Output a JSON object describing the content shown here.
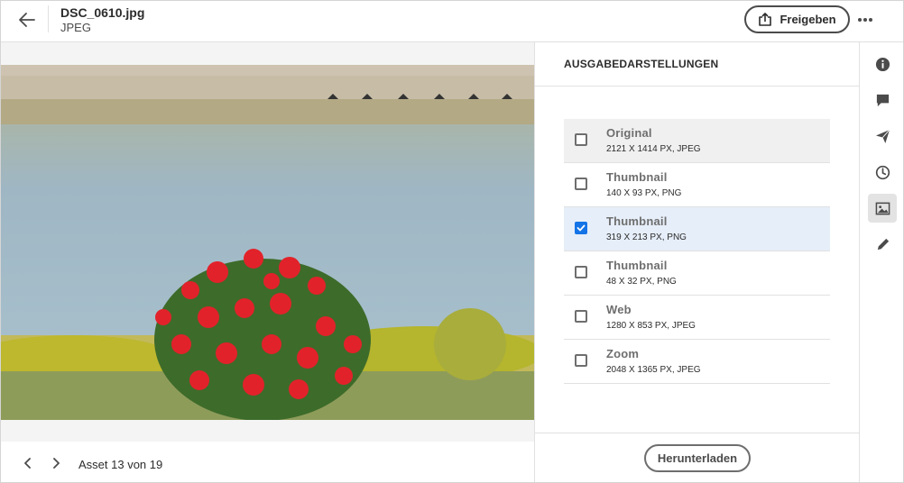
{
  "header": {
    "file_name": "DSC_0610.jpg",
    "file_type": "JPEG",
    "share_label": "Freigeben",
    "back_icon": "arrow-left-icon",
    "more_icon": "more-horizontal-icon",
    "share_icon": "share-icon"
  },
  "viewer": {
    "asset_counter": "Asset 13 von 19",
    "prev_icon": "chevron-left-icon",
    "next_icon": "chevron-right-icon"
  },
  "panel": {
    "title": "AUSGABEDARSTELLUNGEN",
    "renditions": [
      {
        "name": "Original",
        "meta": "2121 X 1414 PX, JPEG",
        "checked": false
      },
      {
        "name": "Thumbnail",
        "meta": "140 X 93 PX, PNG",
        "checked": false
      },
      {
        "name": "Thumbnail",
        "meta": "319 X 213 PX, PNG",
        "checked": true
      },
      {
        "name": "Thumbnail",
        "meta": "48 X 32 PX, PNG",
        "checked": false
      },
      {
        "name": "Web",
        "meta": "1280 X 853 PX, JPEG",
        "checked": false
      },
      {
        "name": "Zoom",
        "meta": "2048 X 1365 PX, JPEG",
        "checked": false
      }
    ],
    "download_label": "Herunterladen"
  },
  "rail": {
    "items": [
      {
        "icon": "info-icon",
        "active": false
      },
      {
        "icon": "comment-icon",
        "active": false
      },
      {
        "icon": "send-icon",
        "active": false
      },
      {
        "icon": "history-clock-icon",
        "active": false
      },
      {
        "icon": "renditions-image-icon",
        "active": true
      },
      {
        "icon": "edit-pencil-icon",
        "active": false
      }
    ]
  },
  "colors": {
    "accent": "#1473e6",
    "selected_row": "#e6eef9",
    "text": "#2c2c2c"
  }
}
